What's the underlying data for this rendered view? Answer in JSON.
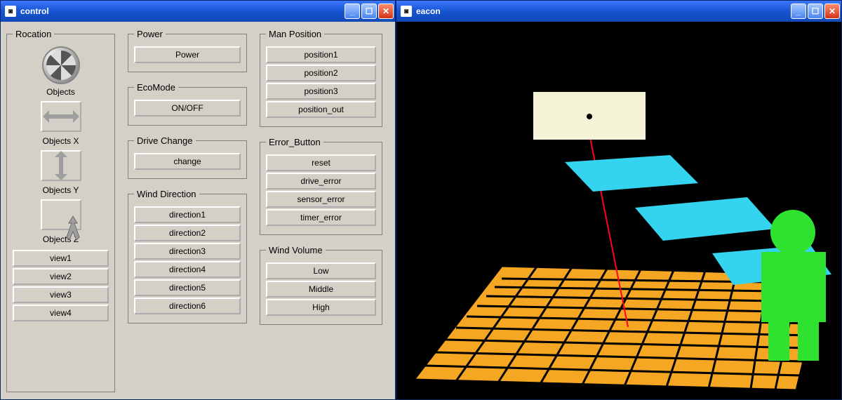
{
  "windows": {
    "control": {
      "title": "control"
    },
    "eacon": {
      "title": "eacon"
    }
  },
  "control": {
    "rocation": {
      "legend": "Rocation",
      "objects_label": "Objects",
      "objects_x_label": "Objects X",
      "objects_y_label": "Objects Y",
      "objects_z_label": "Objects Z",
      "views": [
        "view1",
        "view2",
        "view3",
        "view4"
      ]
    },
    "power": {
      "legend": "Power",
      "button": "Power"
    },
    "ecomode": {
      "legend": "EcoMode",
      "button": "ON/OFF"
    },
    "drive_change": {
      "legend": "Drive Change",
      "button": "change"
    },
    "wind_direction": {
      "legend": "Wind Direction",
      "buttons": [
        "direction1",
        "direction2",
        "direction3",
        "direction4",
        "direction5",
        "direction6"
      ]
    },
    "man_position": {
      "legend": "Man Position",
      "buttons": [
        "position1",
        "position2",
        "position3",
        "position_out"
      ]
    },
    "error_button": {
      "legend": "Error_Button",
      "buttons": [
        "reset",
        "drive_error",
        "sensor_error",
        "timer_error"
      ]
    },
    "wind_volume": {
      "legend": "Wind Volume",
      "buttons": [
        "Low",
        "Middle",
        "High"
      ]
    }
  },
  "scene": {
    "floor_color": "#f5a623",
    "grid_color": "#000000",
    "panel_color": "#f5f3d7",
    "blade_color": "#34d4f0",
    "figure_color": "#2fe22f",
    "line_color": "#ff0022"
  }
}
